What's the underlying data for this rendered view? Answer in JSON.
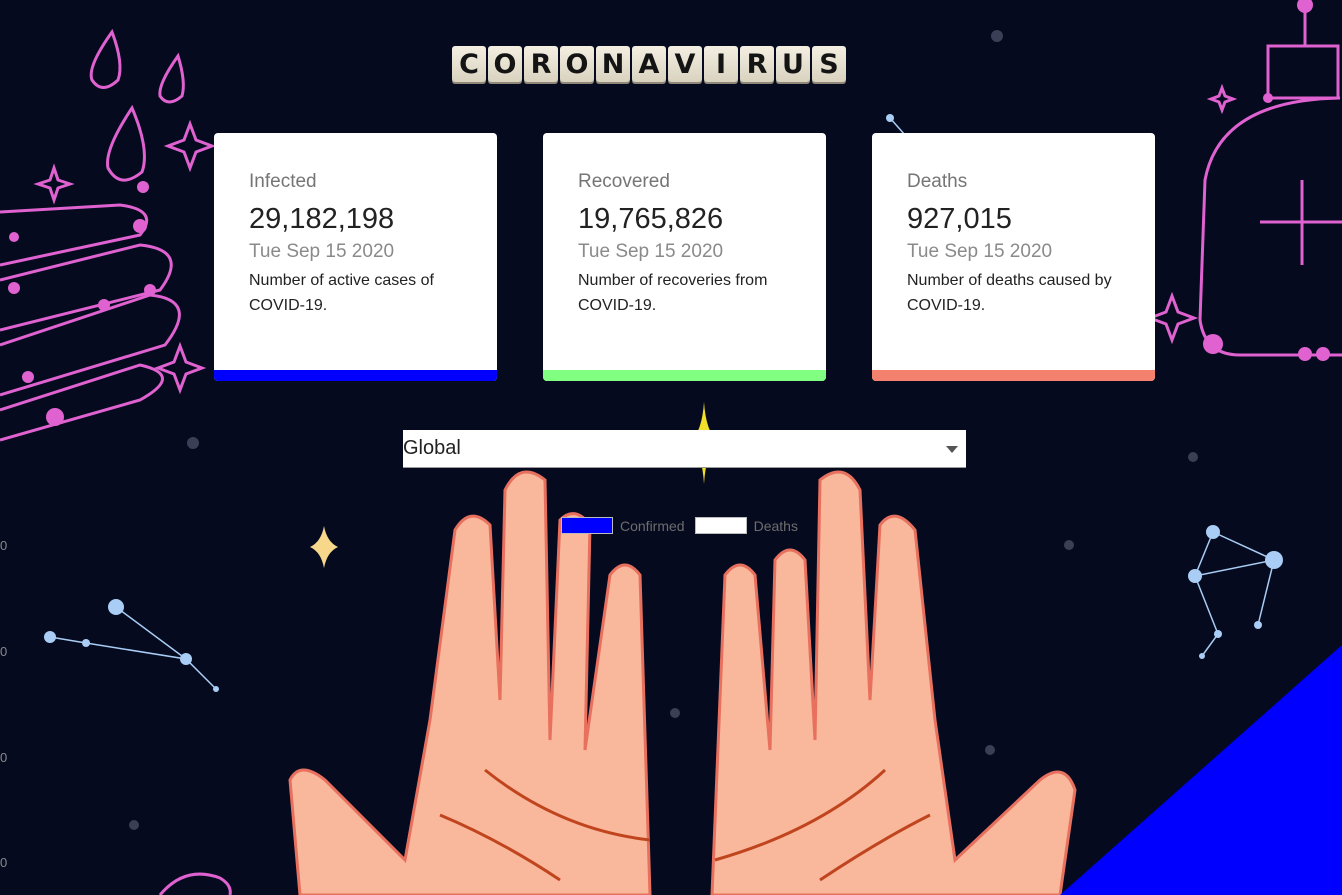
{
  "logo": {
    "letters": [
      "C",
      "O",
      "R",
      "O",
      "N",
      "A",
      "V",
      "I",
      "R",
      "U",
      "S"
    ]
  },
  "cards": {
    "infected": {
      "label": "Infected",
      "value": "29,182,198",
      "date": "Tue Sep 15 2020",
      "description": "Number of active cases of COVID-19.",
      "accent": "#0000ff"
    },
    "recovered": {
      "label": "Recovered",
      "value": "19,765,826",
      "date": "Tue Sep 15 2020",
      "description": "Number of recoveries from COVID-19.",
      "accent": "#80ff80"
    },
    "deaths": {
      "label": "Deaths",
      "value": "927,015",
      "date": "Tue Sep 15 2020",
      "description": "Number of deaths caused by COVID-19.",
      "accent": "#f4806e"
    }
  },
  "country_picker": {
    "selected": "Global"
  },
  "chart": {
    "legend": [
      {
        "label": "Confirmed",
        "color": "#0000ff"
      },
      {
        "label": "Deaths",
        "color": "#ffffff"
      }
    ],
    "y_ticks": [
      "0",
      "0",
      "0",
      "0"
    ]
  },
  "colors": {
    "background": "#050a1f",
    "decor_pink": "#e062d0",
    "decor_blue": "#a9cdf5",
    "hand_skin": "#f9b79b",
    "hand_outline": "#e8705e"
  }
}
